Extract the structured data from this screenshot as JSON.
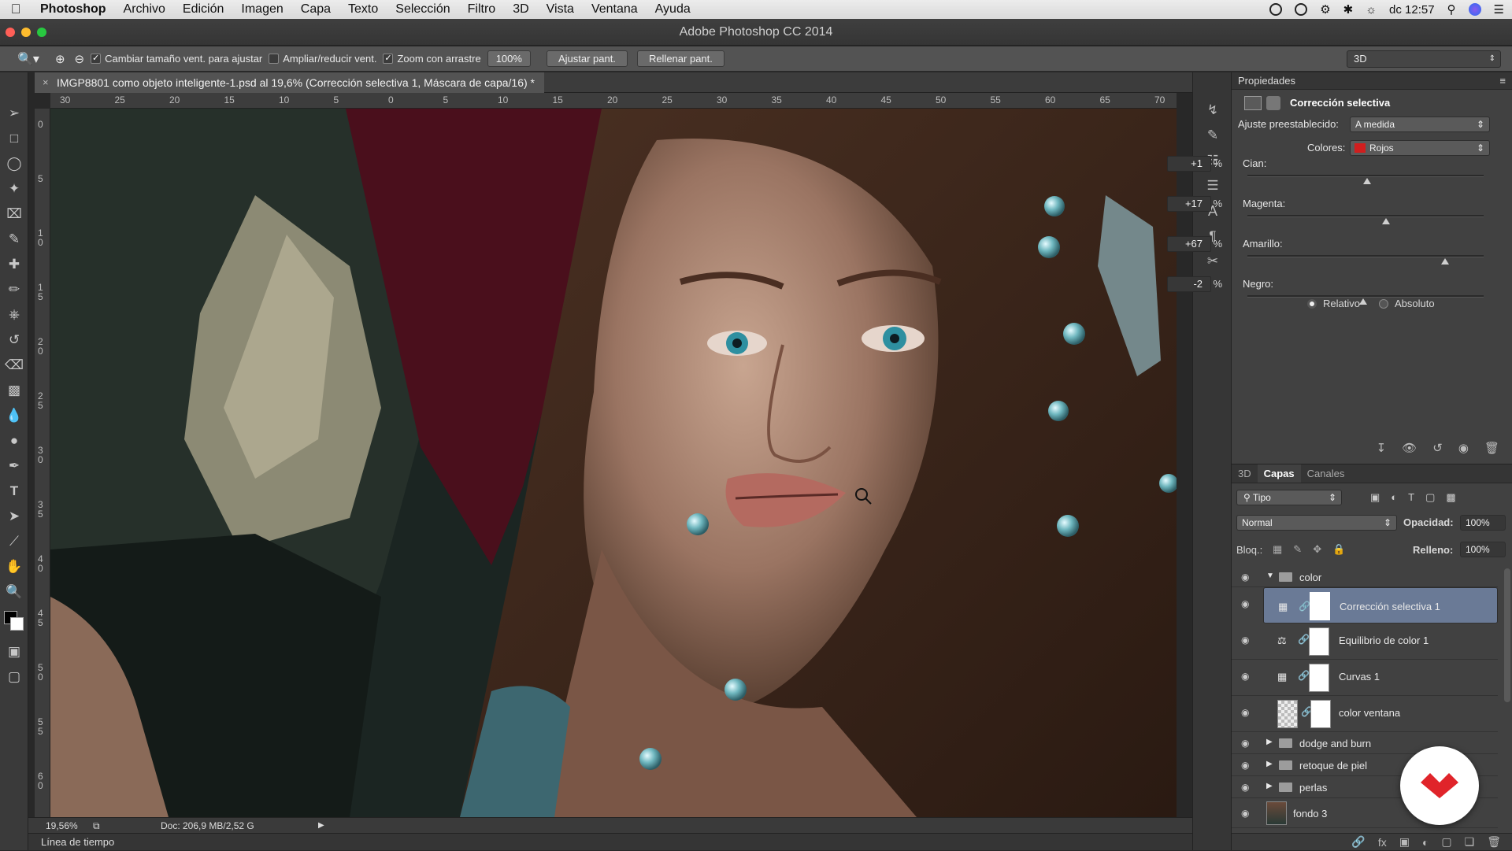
{
  "menubar": {
    "app": "Photoshop",
    "items": [
      "Archivo",
      "Edición",
      "Imagen",
      "Capa",
      "Texto",
      "Selección",
      "Filtro",
      "3D",
      "Vista",
      "Ventana",
      "Ayuda"
    ],
    "clock": "dc 12:57"
  },
  "window": {
    "title": "Adobe Photoshop CC 2014"
  },
  "options": {
    "resize_label": "Cambiar tamaño vent. para ajustar",
    "zoom_all_label": "Ampliar/reducir vent.",
    "scrubby_label": "Zoom con arrastre",
    "zoom_value": "100%",
    "fit_label": "Ajustar pant.",
    "fill_label": "Rellenar pant.",
    "workspace": "3D"
  },
  "document": {
    "tab_title": "IMGP8801 como objeto inteligente-1.psd al 19,6% (Corrección selectiva 1, Máscara de capa/16) *",
    "close": "×"
  },
  "rulers": {
    "h_labels": [
      "30",
      "25",
      "20",
      "15",
      "10",
      "5",
      "0",
      "5",
      "10",
      "15",
      "20",
      "25",
      "30",
      "35",
      "40",
      "45",
      "50",
      "55",
      "60",
      "65",
      "70"
    ],
    "v_labels": [
      "0",
      "5",
      "1 0",
      "1 5",
      "2 0",
      "2 5",
      "3 0",
      "3 5",
      "4 0",
      "4 5",
      "5 0",
      "5 5",
      "6 0"
    ]
  },
  "status": {
    "zoom": "19,56%",
    "doc": "Doc: 206,9 MB/2,52 G"
  },
  "timeline": {
    "label": "Línea de tiempo"
  },
  "properties": {
    "header": "Propiedades",
    "title": "Corrección selectiva",
    "preset_label": "Ajuste preestablecido:",
    "preset_value": "A medida",
    "colors_label": "Colores:",
    "colors_value": "Rojos",
    "colors_swatch": "#d01e1e",
    "sliders": [
      {
        "label": "Cian:",
        "value": "+1",
        "pct": "%",
        "level": 1
      },
      {
        "label": "Magenta:",
        "value": "+17",
        "pct": "%",
        "level": 17
      },
      {
        "label": "Amarillo:",
        "value": "+67",
        "pct": "%",
        "level": 67
      },
      {
        "label": "Negro:",
        "value": "-2",
        "pct": "%",
        "level": -2
      }
    ],
    "relative_label": "Relativo",
    "absolute_label": "Absoluto"
  },
  "layers": {
    "tabs": [
      "3D",
      "Capas",
      "Canales"
    ],
    "filter": "Tipo",
    "blend_mode": "Normal",
    "opacity_label": "Opacidad:",
    "opacity_value": "100%",
    "lock_label": "Bloq.:",
    "fill_label": "Relleno:",
    "fill_value": "100%",
    "rows": [
      {
        "name": "color"
      },
      {
        "name": "Corrección selectiva 1"
      },
      {
        "name": "Equilibrio de color 1"
      },
      {
        "name": "Curvas 1"
      },
      {
        "name": "color ventana"
      },
      {
        "name": "dodge and burn"
      },
      {
        "name": "retoque de piel"
      },
      {
        "name": "perlas"
      },
      {
        "name": "fondo 3"
      }
    ]
  },
  "colors": {
    "accent": "#6a7a96",
    "badge": "#e0242a"
  }
}
